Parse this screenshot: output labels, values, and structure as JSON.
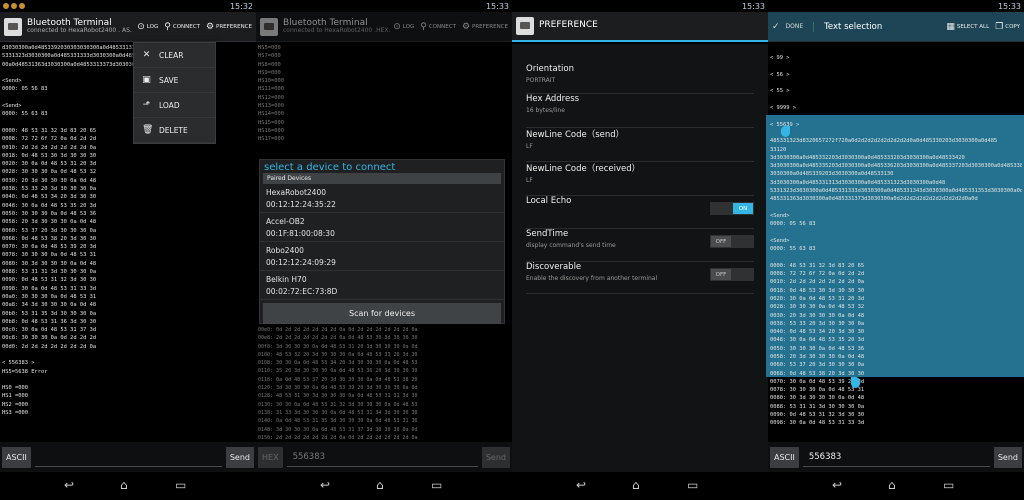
{
  "clocks": [
    "15:32",
    "15:33",
    "15:33",
    "15:33"
  ],
  "p1": {
    "title": "Bluetooth Terminal",
    "subtitle": "connected to HexaRobot2400 . AS.",
    "actions": [
      "LOG",
      "CONNECT",
      "PREFERENCE"
    ],
    "lines": [
      "d3030300a0d4853392030303030300a0d4853313330",
      "5331323d3030300a0d485331333d3030300a0d4853313",
      "00a0d48531363d3030300a0d4853313373d3030300a0d",
      "",
      "<Send>",
      "0000: 05 56 83",
      "",
      "<Send>",
      "0000: 55 63 83",
      "",
      "0000: 48 53 31 32 3d 83 20 65",
      "0008: 72 72 6f 72 0a 0d 2d 2d",
      "0010: 2d 2d 2d 2d 2d 2d 2d 0a",
      "0018: 0d 48 53 30 3d 30 30 30",
      "0020: 30 0a 0d 48 53 31 20 3d",
      "0028: 30 30 30 0a 0d 48 53 32",
      "0030: 20 3d 30 30 30 0a 0d 48",
      "0038: 53 33 20 3d 30 30 30 0a",
      "0040: 0d 48 53 34 20 3d 30 30",
      "0048: 30 0a 0d 48 53 35 20 3d",
      "0050: 30 30 30 0a 0d 48 53 36",
      "0058: 20 3d 30 30 30 0a 0d 48",
      "0060: 53 37 20 3d 30 30 30 0a",
      "0068: 0d 48 53 38 20 3d 30 30",
      "0070: 30 0a 0d 48 53 39 20 3d",
      "0078: 30 30 30 0a 0d 48 53 31",
      "0080: 30 3d 30 30 30 0a 0d 48",
      "0088: 53 31 31 3d 30 30 30 0a",
      "0090: 0d 48 53 31 32 3d 30 30",
      "0098: 30 0a 0d 48 53 31 33 3d",
      "00a0: 30 30 30 0a 0d 48 53 31",
      "00a8: 34 3d 30 30 30 0a 0d 48",
      "00b0: 53 31 35 3d 30 30 30 0a",
      "00b8: 0d 48 53 31 36 3d 30 30",
      "00c0: 30 0a 0d 48 53 31 37 3d",
      "00c8: 30 30 30 0a 0d 2d 2d 2d",
      "00d0: 2d 2d 2d 2d 2d 2d 2d 0a",
      "",
      "< 556383 >",
      "HS5=5638 Error",
      "",
      "HS0 =000",
      "HS1 =000",
      "HS2 =000",
      "HS3 =000"
    ],
    "menu": [
      "CLEAR",
      "SAVE",
      "LOAD",
      "DELETE"
    ],
    "mode": "ASCII",
    "input": "",
    "send": "Send"
  },
  "p2": {
    "title": "Bluetooth Terminal",
    "subtitle": "connected to HexaRobot2400 .HEX.",
    "actions": [
      "LOG",
      "CONNECT",
      "PREFERENCE"
    ],
    "lines": [
      "HS5=000",
      "HS7=000",
      "HS8=000",
      "HS9=000",
      "HS10=000",
      "HS11=000",
      "HS12=000",
      "HS13=000",
      "HS14=000",
      "HS15=000",
      "HS16=000",
      "HS17=000"
    ],
    "lines2": [
      "00e0: 0d 2d 2d 2d 2d 2d 2d 0a 0d 2d 2d 2d 2d 2d 2d 0a",
      "00e8: 2d 2d 2d 2d 2d 2d 2d 0a 0d 48 53 30 3d 30 30 30",
      "00f0: 3d 30 30 30 0a 0d 48 53 31 20 3d 30 30 30 0a 0d",
      "0100: 48 53 32 20 3d 30 30 30 0a 0d 48 53 33 20 3d 30",
      "0108: 30 30 0a 0d 48 53 34 20 3d 30 30 30 0a 0d 48 53",
      "0110: 35 20 3d 30 30 30 0a 0d 48 53 36 20 3d 30 30 30",
      "0118: 0a 0d 48 53 37 20 3d 30 30 30 0a 0d 48 53 38 20",
      "0120: 3d 30 30 30 0a 0d 48 53 39 20 3d 30 30 30 0a 0d",
      "0128: 48 53 31 30 3d 30 30 30 0a 0d 48 53 31 31 3d 30",
      "0130: 30 30 0a 0d 48 53 31 32 3d 30 30 30 0a 0d 48 53",
      "0138: 31 33 3d 30 30 30 0a 0d 48 53 31 34 3d 30 30 30",
      "0140: 0a 0d 48 53 31 35 3d 30 30 30 0a 0d 48 53 31 36",
      "0148: 3d 30 30 30 0a 0d 48 53 31 37 3d 30 30 30 0a 0d",
      "0150: 2d 2d 2d 2d 2d 2d 2d 0a 0d 2d 2d 2d 2d 2d 2d 0a"
    ],
    "dialog": {
      "title": "select a device to connect",
      "section": "Paired Devices",
      "devices": [
        {
          "name": "HexaRobot2400",
          "mac": "00:12:12:24:35:22"
        },
        {
          "name": "Accel-OB2",
          "mac": "00:1F:81:00:08:30"
        },
        {
          "name": "Robo2400",
          "mac": "00:12:12:24:09:29"
        },
        {
          "name": "Belkin H70",
          "mac": "00:02:72:EC:73:8D"
        }
      ],
      "scan": "Scan for devices"
    },
    "mode": "HEX",
    "input": "556383",
    "send": "Send"
  },
  "p3": {
    "title": "PREFERENCE",
    "items": [
      {
        "label": "Orientation",
        "sub": "PORTRAIT"
      },
      {
        "label": "Hex Address",
        "sub": "16 bytes/line"
      },
      {
        "label": "NewLine Code（send）",
        "sub": "LF"
      },
      {
        "label": "NewLine Code（received）",
        "sub": "LF"
      },
      {
        "label": "Local Echo",
        "sub": "",
        "toggle": "ON"
      },
      {
        "label": "SendTime",
        "sub": "display command's send time",
        "toggle": "OFF"
      },
      {
        "label": "Discoverable",
        "sub": "Enable the discovery from another terminal",
        "toggle": "OFF"
      }
    ]
  },
  "p4": {
    "done": "DONE",
    "title": "Text selection",
    "select_all": "SELECT ALL",
    "copy": "COPY",
    "lines": [
      "",
      "< 99 >",
      "",
      "< 56 >",
      "",
      "< 55 >",
      "",
      "< 9999 >",
      "",
      "< 55639 >",
      "",
      "485331323d8320657272f720a0d2d2d2d2d2d2d2d2d0a0d485330203d3030300a0d485",
      "33120",
      "3d3030300a0d485332203d3030300a0d485333203d3030300a0d48533420",
      "3d3030300a0d485335203d3030300a0d485336203d3030300a0d485337203d3030300a0d485338203d",
      "3030300a0d485339203d3030300a0d48533130",
      "3d3030300a0d485331313d3030300a0d485331323d3030300a0d48",
      "5331323d3030300a0d485331333d3030300a0d485331343d3030300a0d485331353d3030300a0d",
      "485331363d3030300a0d485331373d3030300a0d2d2d2d2d2d2d2d2d2d2d0a0d",
      "",
      "<Send>",
      "0000: 05 56 83",
      "",
      "<Send>",
      "0000: 55 63 83",
      "",
      "0000: 48 53 31 32 3d 83 20 65",
      "0008: 72 72 6f 72 0a 0d 2d 2d",
      "0010: 2d 2d 2d 2d 2d 2d 2d 0a",
      "0018: 0d 48 53 30 3d 30 30 30",
      "0020: 30 0a 0d 48 53 31 20 3d",
      "0028: 30 30 30 0a 0d 48 53 32",
      "0030: 20 3d 30 30 30 0a 0d 48",
      "0038: 53 33 20 3d 30 30 30 0a",
      "0040: 0d 48 53 34 20 3d 30 30",
      "0048: 30 0a 0d 48 53 35 20 3d",
      "0050: 30 30 30 0a 0d 48 53 36",
      "0058: 20 3d 30 30 30 0a 0d 48",
      "0060: 53 37 20 3d 30 30 30 0a",
      "0068: 0d 48 53 38 20 3d 30 30",
      "0070: 30 0a 0d 48 53 39 20 3d",
      "0078: 30 30 30 0a 0d 48 53 31",
      "0080: 30 3d 30 30 30 0a 0d 48",
      "0088: 53 31 31 3d 30 30 30 0a",
      "0090: 0d 48 53 31 32 3d 30 30",
      "0098: 30 0a 0d 48 53 31 33 3d"
    ],
    "mode": "ASCII",
    "input": "556383",
    "send": "Send"
  }
}
